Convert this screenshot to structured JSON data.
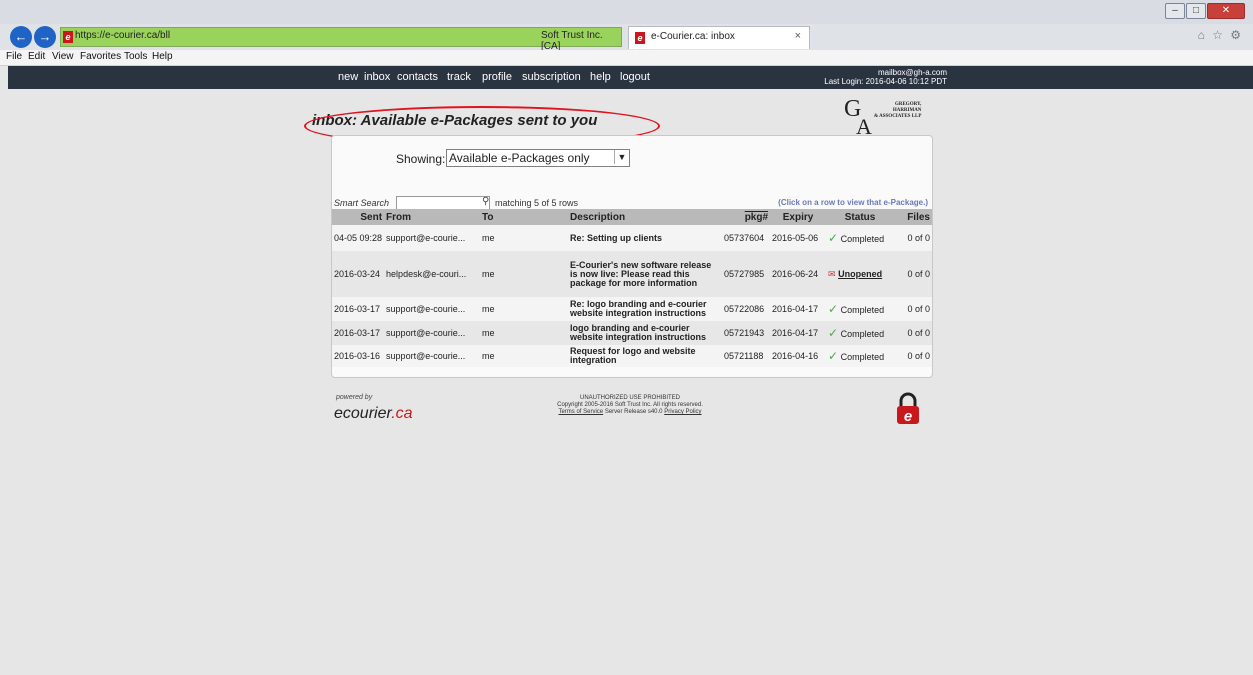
{
  "browser": {
    "url": "https://e-courier.ca/bll",
    "cert": "Soft Trust Inc. [CA]",
    "tab_title": "e-Courier.ca: inbox",
    "menu": [
      "File",
      "Edit",
      "View",
      "Favorites",
      "Tools",
      "Help"
    ]
  },
  "nav": {
    "links": [
      "new",
      "inbox",
      "contacts",
      "track",
      "profile",
      "subscription",
      "help",
      "logout"
    ],
    "user_email": "mailbox@gh-a.com",
    "last_login": "Last Login: 2016-04-06 10:12 PDT"
  },
  "page": {
    "title": "inbox: Available e-Packages sent to you",
    "logo": {
      "mark_g": "G",
      "mark_a": "A",
      "firm": "GREGORY,\nHARRIMAN\n& ASSOCIATES LLP"
    },
    "showing_label": "Showing:",
    "showing_value": "Available e-Packages only",
    "smart_search_label": "Smart Search",
    "matching": "matching 5 of 5 rows",
    "click_hint": "(Click on a row to view that e-Package.)"
  },
  "table": {
    "headers": [
      "Sent",
      "From",
      "To",
      "Description",
      "pkg#",
      "Expiry",
      "Status",
      "Files"
    ],
    "rows": [
      {
        "sent": "04-05 09:28",
        "from": "support@e-courie...",
        "to": "me",
        "desc": "Re: Setting up clients",
        "pkg": "05737604",
        "expiry": "2016-05-06",
        "status": "Completed",
        "files": "0 of 0"
      },
      {
        "sent": "2016-03-24",
        "from": "helpdesk@e-couri...",
        "to": "me",
        "desc": "E-Courier's new software release is now live: Please read this package for more information",
        "pkg": "05727985",
        "expiry": "2016-06-24",
        "status": "Unopened",
        "files": "0 of 0"
      },
      {
        "sent": "2016-03-17",
        "from": "support@e-courie...",
        "to": "me",
        "desc": "Re: logo branding and e-courier website integration instructions",
        "pkg": "05722086",
        "expiry": "2016-04-17",
        "status": "Completed",
        "files": "0 of 0"
      },
      {
        "sent": "2016-03-17",
        "from": "support@e-courie...",
        "to": "me",
        "desc": "logo branding and e-courier website integration instructions",
        "pkg": "05721943",
        "expiry": "2016-04-17",
        "status": "Completed",
        "files": "0 of 0"
      },
      {
        "sent": "2016-03-16",
        "from": "support@e-courie...",
        "to": "me",
        "desc": "Request for logo and website integration",
        "pkg": "05721188",
        "expiry": "2016-04-16",
        "status": "Completed",
        "files": "0 of 0"
      }
    ]
  },
  "footer": {
    "powered_by": "powered by",
    "brand_main": "ecourier",
    "brand_suffix": ".ca",
    "warning": "UNAUTHORIZED USE PROHIBITED",
    "copyright": "Copyright 2005-2016 Soft Trust Inc. All rights reserved.",
    "terms": "Terms of Service",
    "release": "Server Release s40.0",
    "privacy": "Privacy Policy",
    "lock_letter": "e"
  }
}
